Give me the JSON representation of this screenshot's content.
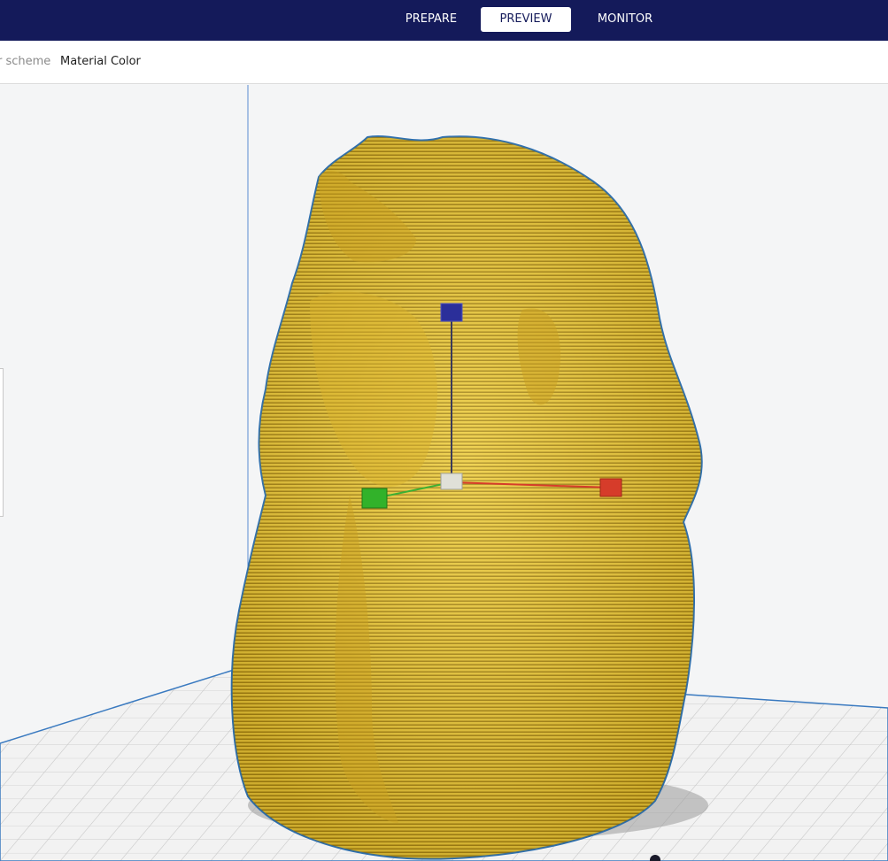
{
  "stages": {
    "prepare": "PREPARE",
    "preview": "PREVIEW",
    "monitor": "MONITOR"
  },
  "color_scheme": {
    "label": "r scheme",
    "value": "Material Color"
  },
  "colors": {
    "header_bg": "#141a5a",
    "model_fill": "#e8c238",
    "model_outline": "#2a6fb3",
    "axis_x": "#d63c2a",
    "axis_y": "#3cb034",
    "axis_z": "#2b2f9a"
  },
  "icons": {
    "handle_z": "blue-cube",
    "handle_x": "red-cube",
    "handle_y": "green-cube",
    "origin": "gray-cube"
  }
}
